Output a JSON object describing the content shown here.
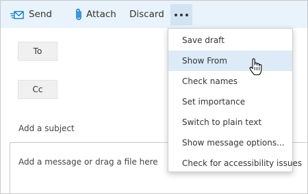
{
  "toolbar": {
    "send_label": "Send",
    "attach_label": "Attach",
    "discard_label": "Discard"
  },
  "compose": {
    "to_label": "To",
    "cc_label": "Cc",
    "subject_placeholder": "Add a subject",
    "body_placeholder": "Add a message or drag a file here"
  },
  "menu": {
    "hovered_item": "Show From",
    "items": [
      {
        "label": "Save draft"
      },
      {
        "label": "Show From"
      },
      {
        "label": "Check names"
      },
      {
        "label": "Set importance"
      },
      {
        "label": "Switch to plain text"
      },
      {
        "label": "Show message options..."
      },
      {
        "label": "Check for accessibility issues"
      }
    ]
  },
  "colors": {
    "toolbar_bg": "#e9f3fb",
    "accent": "#0078d4",
    "hover_bg": "#dcebf7",
    "more_button_bg": "#d2e3f2"
  },
  "icons": {
    "send": "send-envelope-icon",
    "attach": "paperclip-icon",
    "more": "ellipsis-icon",
    "cursor": "hand-pointer-cursor"
  }
}
